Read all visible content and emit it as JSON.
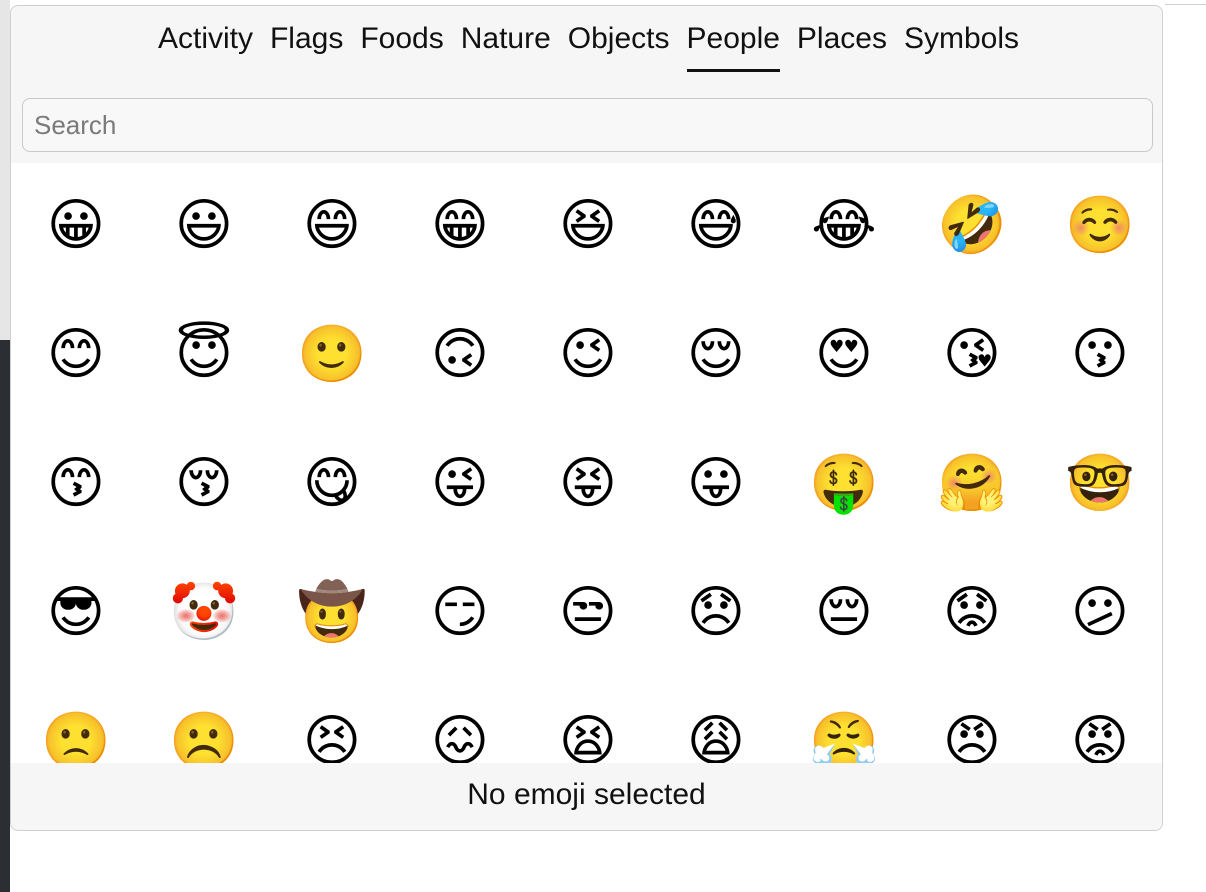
{
  "tabs": [
    {
      "label": "Activity",
      "active": false
    },
    {
      "label": "Flags",
      "active": false
    },
    {
      "label": "Foods",
      "active": false
    },
    {
      "label": "Nature",
      "active": false
    },
    {
      "label": "Objects",
      "active": false
    },
    {
      "label": "People",
      "active": true
    },
    {
      "label": "Places",
      "active": false
    },
    {
      "label": "Symbols",
      "active": false
    }
  ],
  "search": {
    "placeholder": "Search",
    "value": ""
  },
  "emoji_grid": {
    "columns": 9,
    "rows": [
      [
        {
          "char": "😀",
          "name": "grinning-face"
        },
        {
          "char": "😃",
          "name": "grinning-face-big-eyes"
        },
        {
          "char": "😄",
          "name": "grinning-face-smiling-eyes"
        },
        {
          "char": "😁",
          "name": "beaming-face"
        },
        {
          "char": "😆",
          "name": "grinning-squinting-face"
        },
        {
          "char": "😅",
          "name": "grinning-face-sweat"
        },
        {
          "char": "😂",
          "name": "face-tears-of-joy"
        },
        {
          "char": "🤣",
          "name": "rolling-on-floor-laughing"
        },
        {
          "char": "☺️",
          "name": "smiling-face"
        }
      ],
      [
        {
          "char": "😊",
          "name": "smiling-face-smiling-eyes"
        },
        {
          "char": "😇",
          "name": "smiling-face-halo"
        },
        {
          "char": "🙂",
          "name": "slightly-smiling-face"
        },
        {
          "char": "🙃",
          "name": "upside-down-face"
        },
        {
          "char": "😉",
          "name": "winking-face"
        },
        {
          "char": "😌",
          "name": "relieved-face"
        },
        {
          "char": "😍",
          "name": "heart-eyes-face"
        },
        {
          "char": "😘",
          "name": "face-blowing-kiss"
        },
        {
          "char": "😗",
          "name": "kissing-face"
        }
      ],
      [
        {
          "char": "😙",
          "name": "kissing-face-smiling-eyes"
        },
        {
          "char": "😚",
          "name": "kissing-face-closed-eyes"
        },
        {
          "char": "😋",
          "name": "face-savoring-food"
        },
        {
          "char": "😜",
          "name": "winking-face-tongue"
        },
        {
          "char": "😝",
          "name": "squinting-face-tongue"
        },
        {
          "char": "😛",
          "name": "face-with-tongue"
        },
        {
          "char": "🤑",
          "name": "money-mouth-face"
        },
        {
          "char": "🤗",
          "name": "hugging-face"
        },
        {
          "char": "🤓",
          "name": "nerd-face"
        }
      ],
      [
        {
          "char": "😎",
          "name": "smiling-face-sunglasses"
        },
        {
          "char": "🤡",
          "name": "clown-face"
        },
        {
          "char": "🤠",
          "name": "cowboy-hat-face"
        },
        {
          "char": "😏",
          "name": "smirking-face"
        },
        {
          "char": "😒",
          "name": "unamused-face"
        },
        {
          "char": "😞",
          "name": "disappointed-face"
        },
        {
          "char": "😔",
          "name": "pensive-face"
        },
        {
          "char": "😟",
          "name": "worried-face"
        },
        {
          "char": "😕",
          "name": "confused-face"
        }
      ],
      [
        {
          "char": "🙁",
          "name": "slightly-frowning-face"
        },
        {
          "char": "☹️",
          "name": "frowning-face"
        },
        {
          "char": "😣",
          "name": "persevering-face"
        },
        {
          "char": "😖",
          "name": "confounded-face"
        },
        {
          "char": "😫",
          "name": "tired-face"
        },
        {
          "char": "😩",
          "name": "weary-face"
        },
        {
          "char": "😤",
          "name": "face-steam-from-nose"
        },
        {
          "char": "😠",
          "name": "angry-face"
        },
        {
          "char": "😡",
          "name": "pouting-face"
        }
      ]
    ]
  },
  "status": {
    "text": "No emoji selected"
  }
}
